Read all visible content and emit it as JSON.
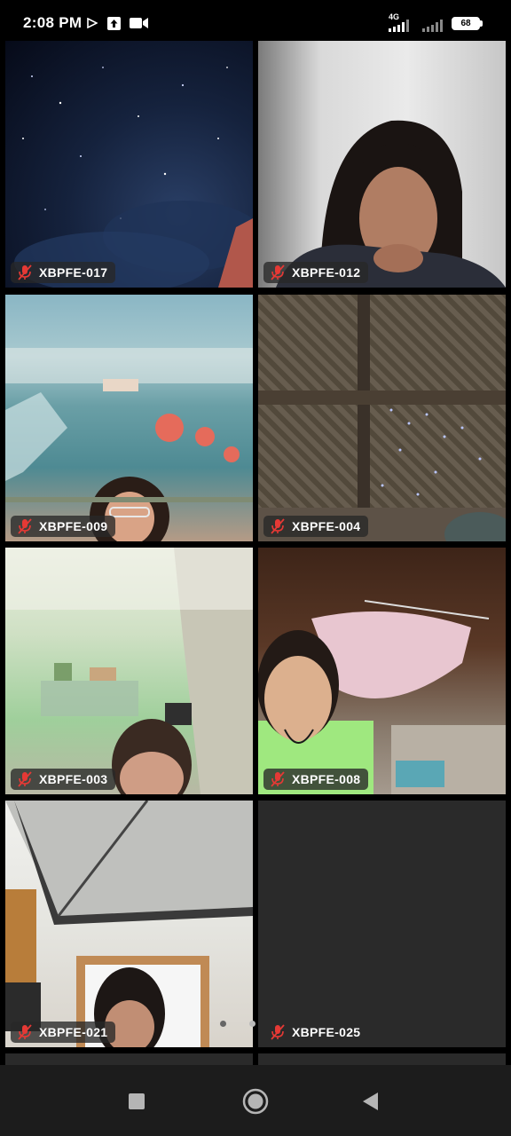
{
  "status_bar": {
    "time": "2:08 PM",
    "network": "4G",
    "battery": "68"
  },
  "participants": [
    {
      "name": "XBPFE-017",
      "muted": true
    },
    {
      "name": "XBPFE-012",
      "muted": true
    },
    {
      "name": "XBPFE-009",
      "muted": true
    },
    {
      "name": "XBPFE-004",
      "muted": true
    },
    {
      "name": "XBPFE-003",
      "muted": true
    },
    {
      "name": "XBPFE-008",
      "muted": true
    },
    {
      "name": "XBPFE-021",
      "muted": true
    },
    {
      "name": "XBPFE-025",
      "muted": true
    }
  ],
  "icons": {
    "mic_muted": "mic-off-icon",
    "nav_recents": "square-icon",
    "nav_home": "circle-icon",
    "nav_back": "triangle-back-icon"
  },
  "colors": {
    "background": "#000000",
    "tile_empty": "#2a2a2a",
    "mute_red": "#e53935",
    "navbar": "#1c1c1c"
  }
}
